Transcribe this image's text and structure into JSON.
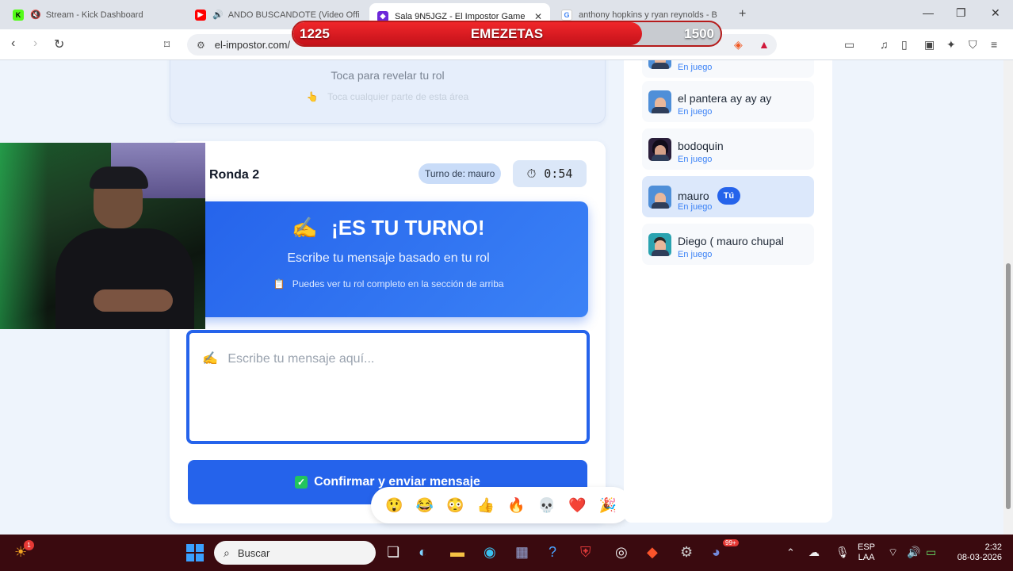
{
  "browser": {
    "tabs": [
      {
        "title": "Stream - Kick Dashboard",
        "favicon": "kick-icon",
        "color": "#53fc18"
      },
      {
        "title": "ANDO BUSCANDOTE (Video Offi",
        "favicon": "youtube-icon",
        "color": "#ff0000"
      },
      {
        "title": "Sala 9N5JGZ - El Impostor Game",
        "favicon": "impostor-icon",
        "color": "#6d28d9"
      },
      {
        "title": "anthony hopkins y ryan reynolds - B",
        "favicon": "google-icon",
        "color": "#4285f4"
      }
    ],
    "url": "el-impostor.com/"
  },
  "stream_overlay": {
    "left_value": "1225",
    "name": "EMEZETAS",
    "right_value": "1500",
    "progress_fraction": 0.8167
  },
  "role_card": {
    "hint": "Toca para revelar tu rol",
    "subhint": "Toca cualquier parte de esta área",
    "subhint_icon": "👆"
  },
  "game": {
    "round": "Ronda 2",
    "turn": "Turno de: mauro",
    "timer": "0:54",
    "timer_icon": "⏱",
    "banner_icon": "✍",
    "banner_title": "¡ES TU TURNO!",
    "banner_subtitle": "Escribe tu mensaje basado en tu rol",
    "banner_note_icon": "📋",
    "banner_note": "Puedes ver tu rol completo en la sección de arriba",
    "input_icon": "✍",
    "input_placeholder": "Escribe tu mensaje aquí...",
    "send_icon": "✓",
    "send_label": "Confirmar y enviar mensaje"
  },
  "reactions": [
    "😲",
    "😂",
    "😳",
    "👍",
    "🔥",
    "💀",
    "❤️",
    "🎉"
  ],
  "players": [
    {
      "name": "",
      "status": "En juego",
      "avatar": "bald-avatar"
    },
    {
      "name": "el pantera ay ay ay",
      "status": "En juego",
      "avatar": "bald-avatar"
    },
    {
      "name": "bodoquin",
      "status": "En juego",
      "avatar": "dark-hair-avatar"
    },
    {
      "name": "mauro",
      "status": "En juego",
      "avatar": "bald-avatar",
      "badge": "Tú"
    },
    {
      "name": "Diego ( mauro chupal",
      "status": "En juego",
      "avatar": "teal-avatar"
    }
  ],
  "taskbar": {
    "search_placeholder": "Buscar",
    "lang_top": "ESP",
    "lang_bottom": "LAA",
    "time": "2:32",
    "date": "08-03-2026",
    "notification_count": "1",
    "discord_badge": "99+"
  }
}
